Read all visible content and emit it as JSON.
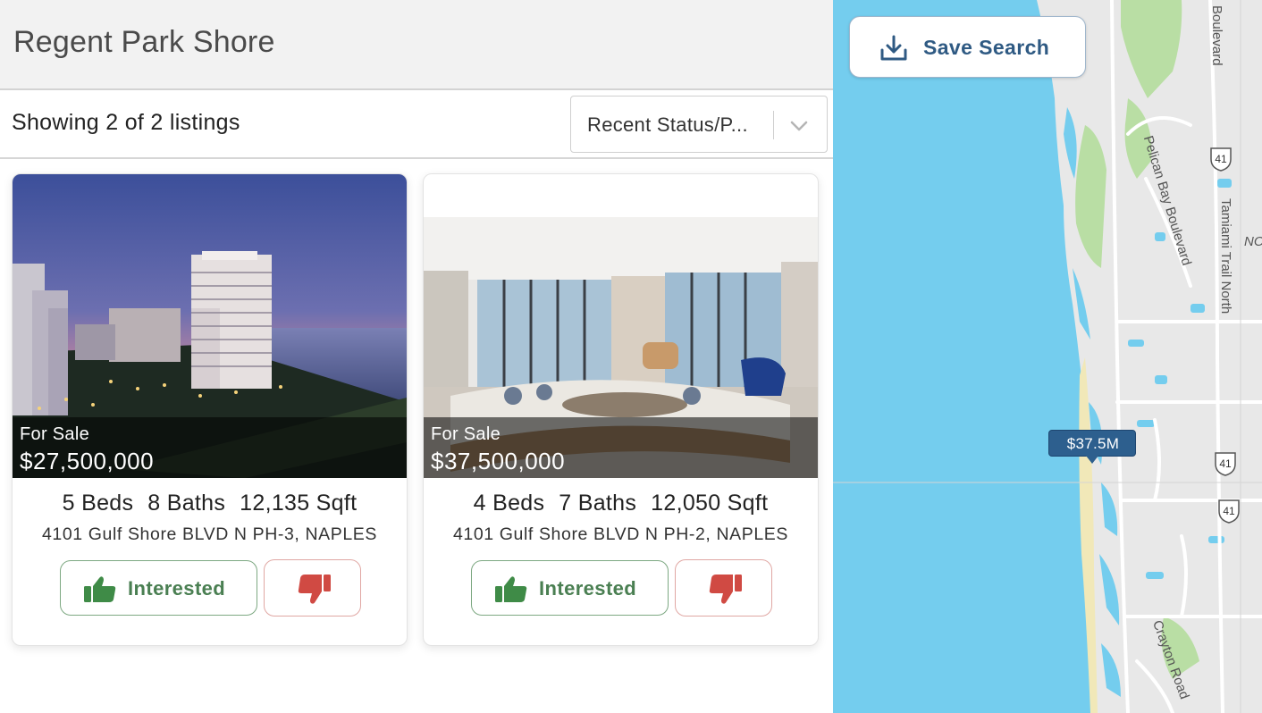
{
  "header": {
    "title": "Regent Park Shore"
  },
  "toolbar": {
    "showing_text": "Showing 2 of 2 listings",
    "sort_value": "Recent Status/P..."
  },
  "listings": [
    {
      "status": "For Sale",
      "price": "$27,500,000",
      "beds": "5 Beds",
      "baths": "8 Baths",
      "sqft": "12,135 Sqft",
      "address": "4101 Gulf Shore BLVD N PH-3, NAPLES",
      "interested_label": "Interested"
    },
    {
      "status": "For Sale",
      "price": "$37,500,000",
      "beds": "4 Beds",
      "baths": "7 Baths",
      "sqft": "12,050 Sqft",
      "address": "4101 Gulf Shore BLVD N PH-2, NAPLES",
      "interested_label": "Interested"
    }
  ],
  "map": {
    "save_search_label": "Save Search",
    "marker_label": "$37.5M",
    "road_labels": {
      "boulevard": "Boulevard",
      "pelican_bay": "Pelican Bay Boulevard",
      "tamiami": "Tamiami Trail North",
      "crayton": "Crayton Road",
      "edge": "NO"
    },
    "highway_shield": "41"
  },
  "icons": {
    "sort_chevron": "chevron-down-icon",
    "interested": "thumbs-up-icon",
    "dislike": "thumbs-down-icon",
    "save_search": "download-icon"
  },
  "colors": {
    "interested": "#4a7f52",
    "dislike": "#d04a43",
    "save_search": "#2f5a83",
    "marker": "#2d5f8e",
    "water": "#74cdee"
  }
}
